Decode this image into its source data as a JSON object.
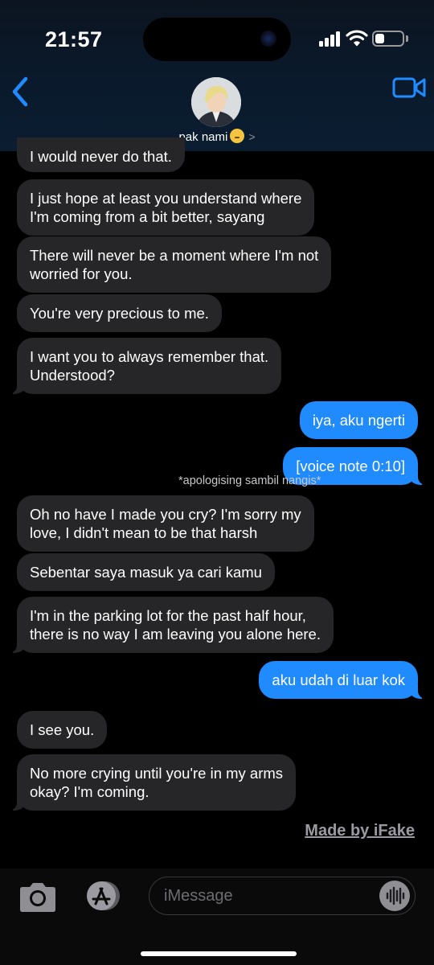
{
  "status_bar": {
    "time": "21:57",
    "battery_level": 0.35
  },
  "header": {
    "contact_name": "pak nami",
    "contact_emoji": "shushing-face-emoji",
    "back_icon": "chevron-left-icon",
    "video_icon": "video-camera-icon"
  },
  "messages": [
    {
      "direction": "in",
      "text": "I would never do that."
    },
    {
      "direction": "in",
      "text": "I just hope at least you understand where\nI'm coming from a bit better, sayang"
    },
    {
      "direction": "in",
      "text": "There will never be a moment where I'm not\nworried for you."
    },
    {
      "direction": "in",
      "text": "You're very precious to me."
    },
    {
      "direction": "in",
      "text": "I want you to always remember that.\nUnderstood?"
    },
    {
      "direction": "out",
      "text": "iya, aku ngerti"
    },
    {
      "direction": "out",
      "text": "[voice note 0:10]"
    },
    {
      "direction": "in",
      "text": "Oh no have I made you cry? I'm sorry my\nlove, I didn't mean to be that harsh"
    },
    {
      "direction": "in",
      "text": "Sebentar saya masuk ya cari kamu"
    },
    {
      "direction": "in",
      "text": "I'm in the parking lot for the past half hour,\nthere is no way I am leaving you alone here."
    },
    {
      "direction": "out",
      "text": "aku udah di luar kok"
    },
    {
      "direction": "in",
      "text": "I see you."
    },
    {
      "direction": "in",
      "text": "No more crying until you're in my arms\nokay? I'm coming."
    }
  ],
  "note": "*apologising sambil nangis*",
  "watermark": "Made by iFake",
  "input": {
    "placeholder": "iMessage"
  },
  "colors": {
    "outgoing": "#1f8bff",
    "incoming": "#262628",
    "accent": "#1f8bff"
  }
}
